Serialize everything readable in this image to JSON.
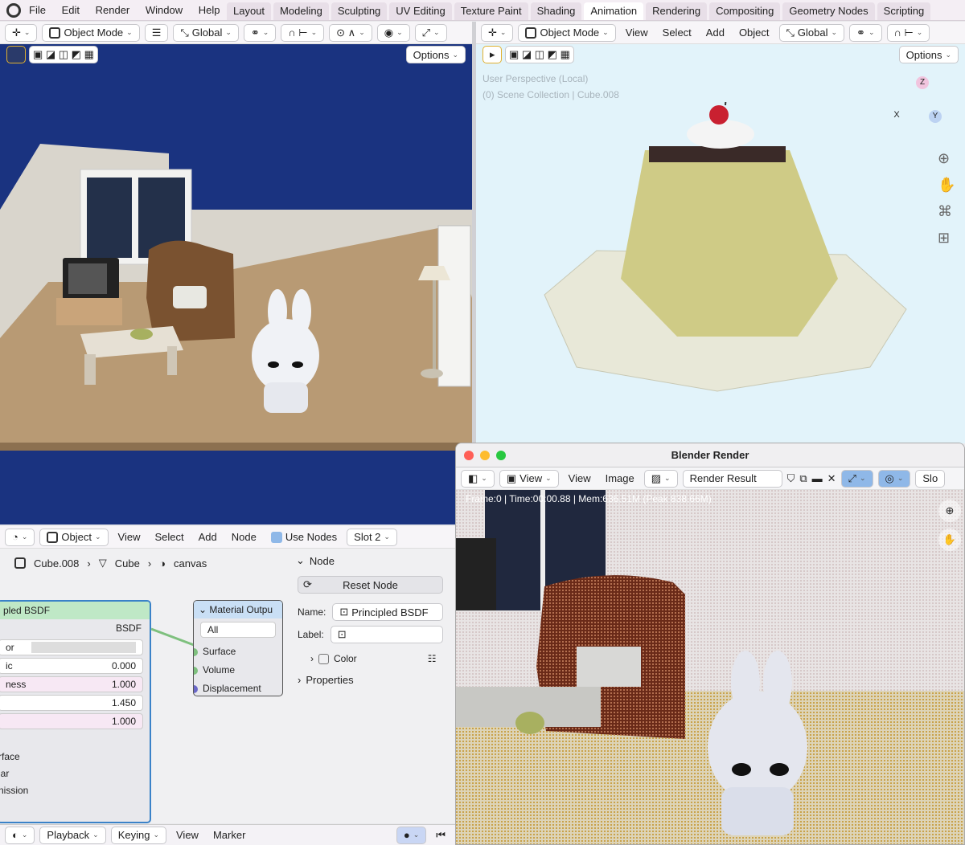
{
  "menubar": {
    "items": [
      "File",
      "Edit",
      "Render",
      "Window",
      "Help"
    ]
  },
  "workspace_tabs": [
    "Layout",
    "Modeling",
    "Sculpting",
    "UV Editing",
    "Texture Paint",
    "Shading",
    "Animation",
    "Rendering",
    "Compositing",
    "Geometry Nodes",
    "Scripting"
  ],
  "active_tab": "Animation",
  "left_viewport": {
    "mode": "Object Mode",
    "orientation": "Global",
    "options_label": "Options"
  },
  "right_viewport": {
    "mode": "Object Mode",
    "menus": [
      "View",
      "Select",
      "Add",
      "Object"
    ],
    "orientation": "Global",
    "options_label": "Options",
    "overlay_line1": "User Perspective (Local)",
    "overlay_line2": "(0) Scene Collection | Cube.008",
    "gizmo": {
      "x": "X",
      "y": "Y",
      "z": "Z"
    }
  },
  "node_editor": {
    "type": "Object",
    "menus": [
      "View",
      "Select",
      "Add",
      "Node"
    ],
    "use_nodes_label": "Use Nodes",
    "slot": "Slot 2",
    "breadcrumb": [
      "Cube.008",
      "Cube",
      "canvas"
    ],
    "bsdf_node": {
      "title": "pled BSDF",
      "output": "BSDF",
      "rows": [
        {
          "label": "or",
          "value": ""
        },
        {
          "label": "ic",
          "value": "0.000"
        },
        {
          "label": "ness",
          "value": "1.000"
        },
        {
          "label": "",
          "value": "1.450"
        },
        {
          "label": "",
          "value": "1.000"
        }
      ],
      "more": [
        "rface",
        "lar",
        "nission"
      ]
    },
    "output_node": {
      "title": "Material Outpu",
      "target": "All",
      "sockets": [
        "Surface",
        "Volume",
        "Displacement"
      ]
    },
    "sidebar": {
      "section_node": "Node",
      "reset_label": "Reset Node",
      "name_label": "Name:",
      "name_value": "Principled BSDF",
      "label_label": "Label:",
      "label_value": "",
      "color_label": "Color",
      "properties_label": "Properties"
    }
  },
  "timeline": {
    "menus": [
      "Playback",
      "Keying",
      "View",
      "Marker"
    ]
  },
  "render_window": {
    "title": "Blender Render",
    "menus": [
      "View",
      "View",
      "Image"
    ],
    "result": "Render Result",
    "slot_short": "Slo",
    "stats": "Frame:0 | Time:00:00.88 | Mem:636.51M (Peak 838.66M)"
  },
  "colors": {
    "viewport_bg": "#1a3380",
    "node_header_bsdf": "#bfe8c6",
    "node_header_output": "#c9dff5",
    "active_tab": "#ffffff"
  }
}
